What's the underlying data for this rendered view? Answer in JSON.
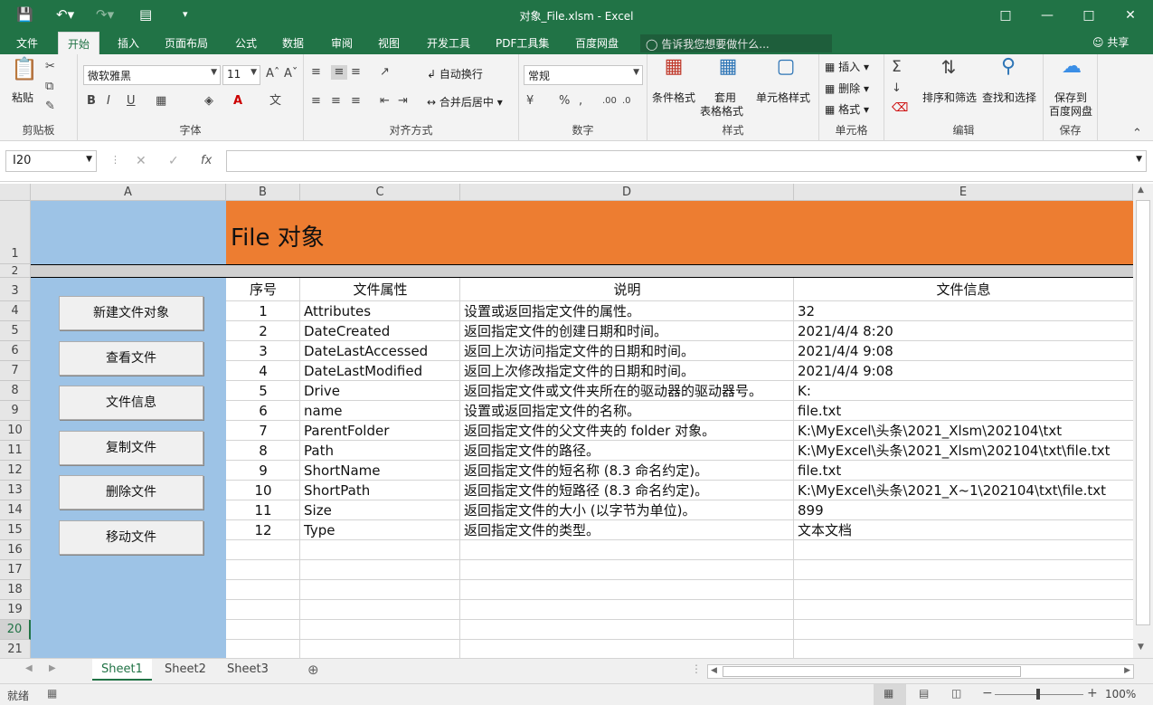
{
  "window": {
    "title": "对象_File.xlsm  -  Excel"
  },
  "ribbon_tabs": [
    "文件",
    "开始",
    "插入",
    "页面布局",
    "公式",
    "数据",
    "审阅",
    "视图",
    "开发工具",
    "PDF工具集",
    "百度网盘"
  ],
  "tell_me": "告诉我您想要做什么...",
  "share": "共享",
  "ribbon": {
    "clipboard": {
      "label": "剪贴板",
      "paste": "粘贴"
    },
    "font": {
      "label": "字体",
      "name": "微软雅黑",
      "size": "11"
    },
    "alignment": {
      "label": "对齐方式",
      "wrap": "自动换行",
      "merge": "合并后居中"
    },
    "number": {
      "label": "数字",
      "format": "常规"
    },
    "styles": {
      "label": "样式",
      "cond": "条件格式",
      "table1": "套用",
      "table2": "表格格式",
      "cell": "单元格样式"
    },
    "cells": {
      "label": "单元格",
      "insert": "插入",
      "delete": "删除",
      "format": "格式"
    },
    "editing": {
      "label": "编辑",
      "sort": "排序和筛选",
      "find": "查找和选择"
    },
    "save": {
      "label": "保存",
      "line1": "保存到",
      "line2": "百度网盘"
    }
  },
  "name_box": "I20",
  "columns": [
    "A",
    "B",
    "C",
    "D",
    "E"
  ],
  "rows": [
    "1",
    "2",
    "3",
    "4",
    "5",
    "6",
    "7",
    "8",
    "9",
    "10",
    "11",
    "12",
    "13",
    "14",
    "15",
    "16",
    "17",
    "18",
    "19",
    "20",
    "21"
  ],
  "sheet_title": "File 对象",
  "headers": [
    "序号",
    "文件属性",
    "说明",
    "文件信息"
  ],
  "table": [
    [
      "1",
      "Attributes",
      "设置或返回指定文件的属性。",
      "32"
    ],
    [
      "2",
      "DateCreated",
      "返回指定文件的创建日期和时间。",
      "2021/4/4 8:20"
    ],
    [
      "3",
      "DateLastAccessed",
      "返回上次访问指定文件的日期和时间。",
      "2021/4/4 9:08"
    ],
    [
      "4",
      "DateLastModified",
      "返回上次修改指定文件的日期和时间。",
      "2021/4/4 9:08"
    ],
    [
      "5",
      "Drive",
      "返回指定文件或文件夹所在的驱动器的驱动器号。",
      "K:"
    ],
    [
      "6",
      "name",
      "设置或返回指定文件的名称。",
      "file.txt"
    ],
    [
      "7",
      "ParentFolder",
      "返回指定文件的父文件夹的 folder 对象。",
      "K:\\MyExcel\\头条\\2021_Xlsm\\202104\\txt"
    ],
    [
      "8",
      "Path",
      "返回指定文件的路径。",
      "K:\\MyExcel\\头条\\2021_Xlsm\\202104\\txt\\file.txt"
    ],
    [
      "9",
      "ShortName",
      "返回指定文件的短名称 (8.3 命名约定)。",
      "file.txt"
    ],
    [
      "10",
      "ShortPath",
      "返回指定文件的短路径 (8.3 命名约定)。",
      "K:\\MyExcel\\头条\\2021_X~1\\202104\\txt\\file.txt"
    ],
    [
      "11",
      "Size",
      "返回指定文件的大小 (以字节为单位)。",
      "899"
    ],
    [
      "12",
      "Type",
      "返回指定文件的类型。",
      "文本文档"
    ]
  ],
  "buttons": [
    "新建文件对象",
    "查看文件",
    "文件信息",
    "复制文件",
    "删除文件",
    "移动文件"
  ],
  "sheets": [
    "Sheet1",
    "Sheet2",
    "Sheet3"
  ],
  "status": {
    "ready": "就绪",
    "zoom": "100%"
  },
  "colors": {
    "excel_green": "#217346",
    "header_orange": "#ED7D31",
    "sidebar_blue": "#9DC3E6",
    "separator_gray": "#D0D0D0"
  }
}
